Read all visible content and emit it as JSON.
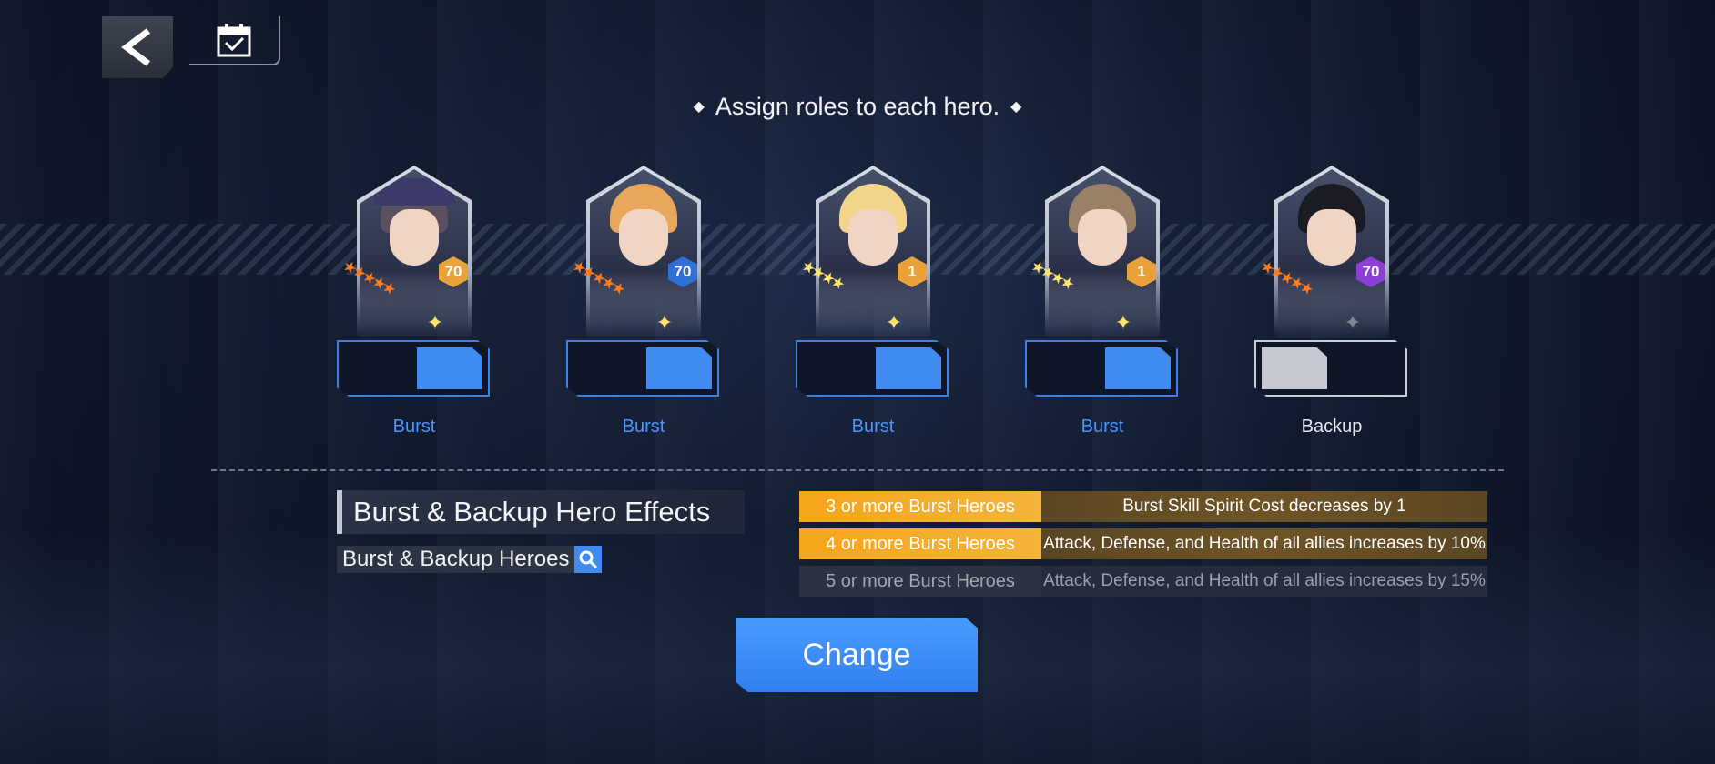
{
  "instruction": "Assign roles to each hero.",
  "heroes": [
    {
      "level": "70",
      "level_color": "#e9a23a",
      "stars": 5,
      "star_color": "#ff7a1a",
      "sparkle_color": "#ffe26a",
      "hair": "#5b5060",
      "hat": "#3b3a6a",
      "role": "Burst",
      "role_color": "#4a95ff"
    },
    {
      "level": "70",
      "level_color": "#2f6fd8",
      "stars": 5,
      "star_color": "#ff7a1a",
      "sparkle_color": "#ffe26a",
      "hair": "#e8a75a",
      "hat": "",
      "role": "Burst",
      "role_color": "#4a95ff"
    },
    {
      "level": "1",
      "level_color": "#e9a23a",
      "stars": 4,
      "star_color": "#ffe66b",
      "sparkle_color": "#ffe26a",
      "hair": "#f0d58a",
      "hat": "",
      "role": "Burst",
      "role_color": "#4a95ff"
    },
    {
      "level": "1",
      "level_color": "#e9a23a",
      "stars": 4,
      "star_color": "#ffe66b",
      "sparkle_color": "#ffe26a",
      "hair": "#9b8068",
      "hat": "",
      "role": "Burst",
      "role_color": "#4a95ff"
    },
    {
      "level": "70",
      "level_color": "#8b3fd6",
      "stars": 5,
      "star_color": "#ff7a1a",
      "sparkle_color": "#808895",
      "hair": "#1b1b24",
      "hat": "",
      "role": "Backup",
      "role_color": "#e6e8ee"
    }
  ],
  "effects_title": "Burst & Backup Hero Effects",
  "heroes_link": "Burst & Backup Heroes",
  "effects": [
    {
      "condition": "3 or more Burst Heroes",
      "description": "Burst Skill Spirit Cost decreases by 1",
      "active": true
    },
    {
      "condition": "4 or more Burst Heroes",
      "description": "Attack, Defense, and Health of all allies increases by 10%",
      "active": true
    },
    {
      "condition": "5 or more Burst Heroes",
      "description": "Attack, Defense, and Health of all allies increases by 15%",
      "active": false
    }
  ],
  "change_label": "Change",
  "colors": {
    "burst": "#3f8bf0",
    "backup": "#c6c9d2",
    "accent_orange": "#f6a51a"
  }
}
